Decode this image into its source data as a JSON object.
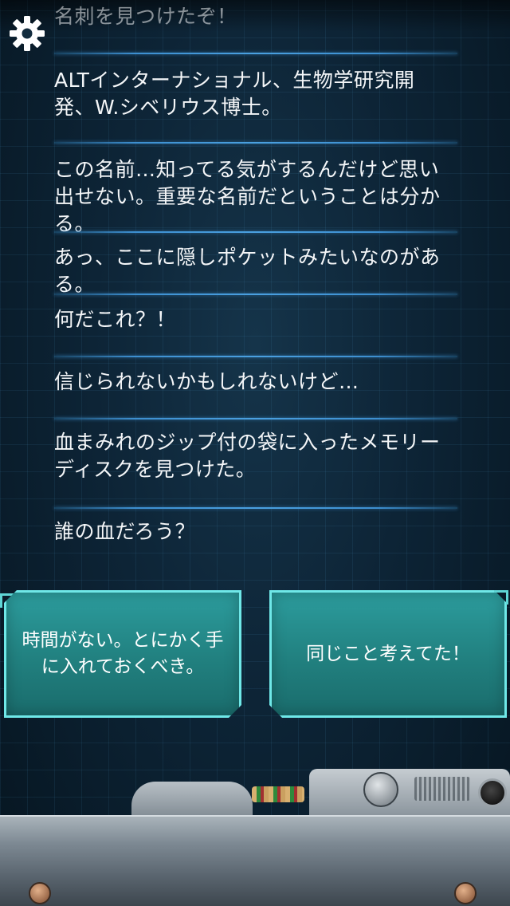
{
  "settings": {
    "icon": "gear-icon"
  },
  "messages": [
    "名刺を見つけたぞ！",
    "ALTインターナショナル、生物学研究開発、W.シベリウス博士。",
    "この名前…知ってる気がするんだけど思い出せない。重要な名前だということは分かる。",
    "あっ、ここに隠しポケットみたいなのがある。",
    "何だこれ？！",
    "信じられないかもしれないけど…",
    "血まみれのジップ付の袋に入ったメモリーディスクを見つけた。",
    "誰の血だろう？"
  ],
  "choices": {
    "left": "時間がない。とにかく手に入れておくべき。",
    "right": "同じこと考えてた！"
  },
  "colors": {
    "accent": "#6fe8e8",
    "choice_fill": "#21807f",
    "separator": "#3d8fd0"
  }
}
